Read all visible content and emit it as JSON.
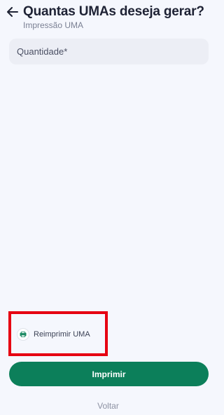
{
  "header": {
    "title": "Quantas UMAs deseja gerar?",
    "subtitle": "Impressão UMA",
    "back_icon": "arrow-left-icon"
  },
  "form": {
    "quantity_placeholder": "Quantidade*",
    "quantity_value": ""
  },
  "reprint": {
    "label": "Reimprimir UMA",
    "icon": "printer-icon",
    "highlight_color": "#e60012"
  },
  "actions": {
    "print_label": "Imprimir",
    "back_label": "Voltar"
  },
  "colors": {
    "background": "#f5f7fd",
    "primary": "#0c7f5a",
    "title": "#1e2234",
    "muted": "#7b8194"
  }
}
